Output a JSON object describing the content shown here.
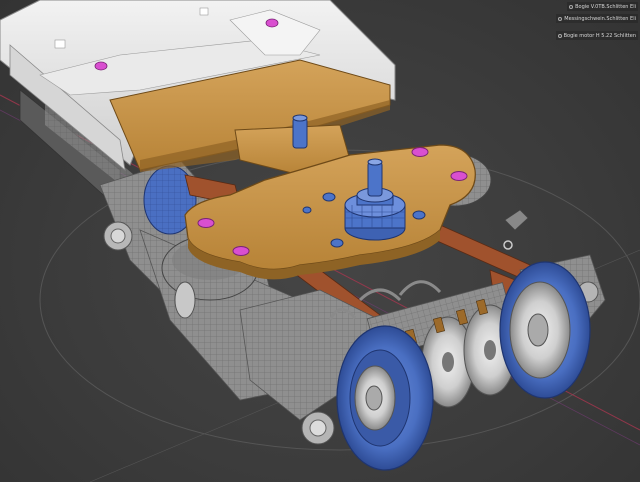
{
  "viewport": {
    "overlay": [
      {
        "text": "Bogie V.0TB.Schlitten Eli"
      },
      {
        "text": "Messingschwein.Schlitten Eli"
      },
      {
        "text": "Bogie motor H 5.22 Schlitten"
      }
    ]
  },
  "colors": {
    "background": "#3a3a3a",
    "platform_white": "#e6e6e6",
    "plate_orange": "#c8964a",
    "mesh_grey": "#9a9a9a",
    "wheel_blue": "#4a6fc2",
    "pin_blue": "#4c74c9",
    "bolt_pink": "#d94fd0",
    "strap_brown": "#a0522d",
    "guide_red": "#b0344a"
  }
}
